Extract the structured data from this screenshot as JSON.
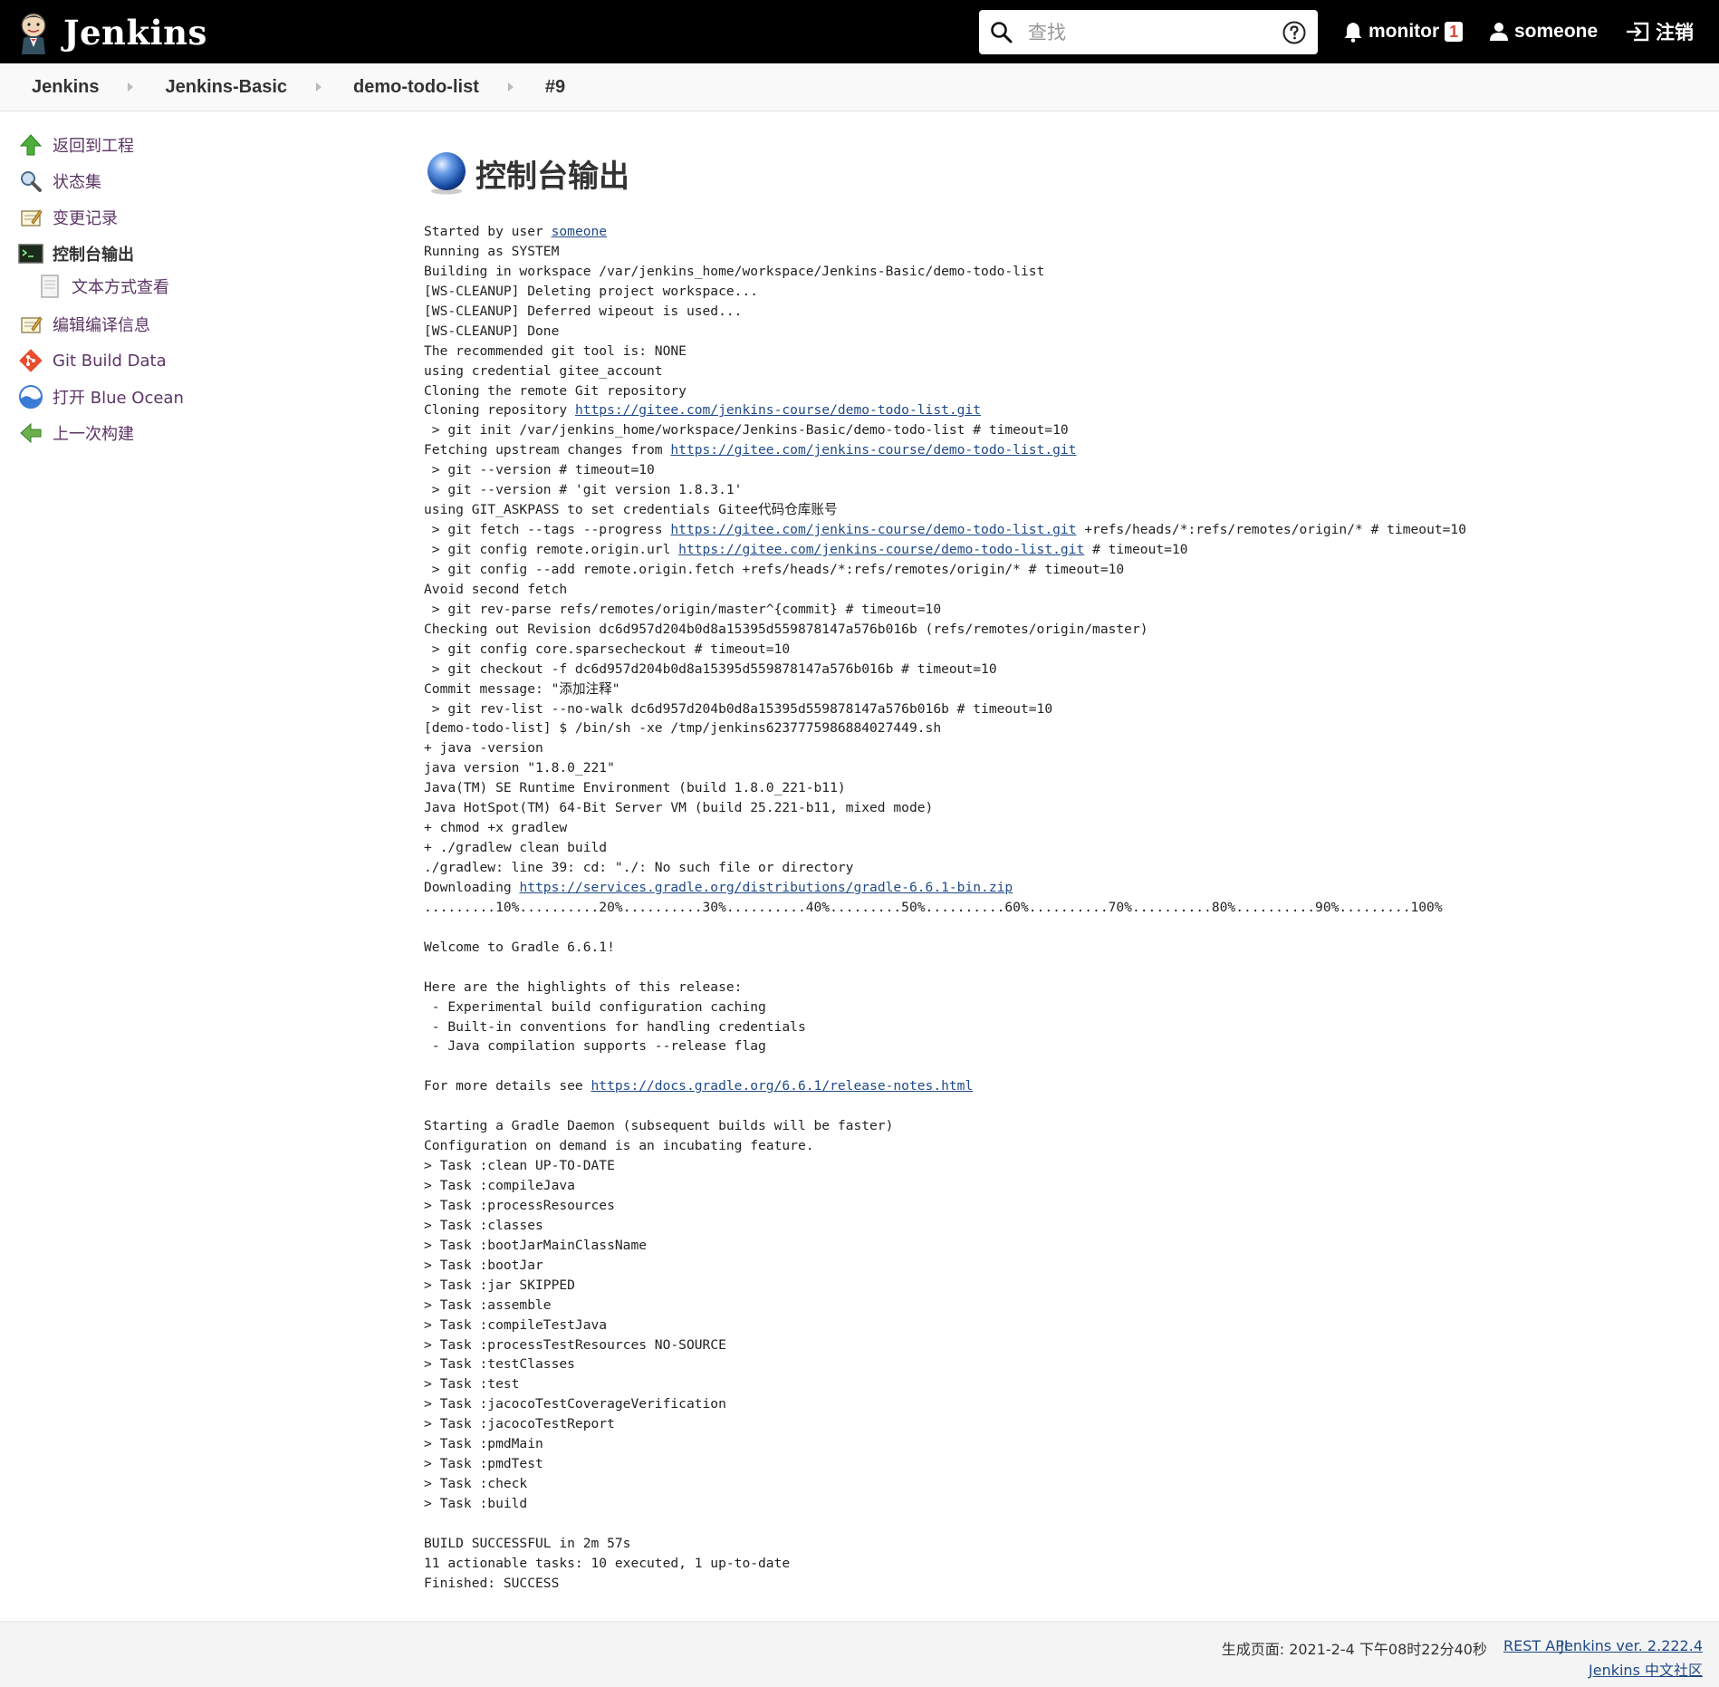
{
  "header": {
    "brand": "Jenkins",
    "search_placeholder": "查找",
    "monitor_label": "monitor",
    "monitor_count": "1",
    "user_name": "someone",
    "logout_label": "注销"
  },
  "breadcrumbs": [
    "Jenkins",
    "Jenkins-Basic",
    "demo-todo-list",
    "#9"
  ],
  "side_panel": {
    "items": [
      {
        "label": "返回到工程",
        "icon": "up-arrow-icon"
      },
      {
        "label": "状态集",
        "icon": "magnifier-icon"
      },
      {
        "label": "变更记录",
        "icon": "notepad-icon"
      },
      {
        "label": "控制台输出",
        "icon": "terminal-icon"
      },
      {
        "label": "文本方式查看",
        "icon": "document-icon"
      },
      {
        "label": "编辑编译信息",
        "icon": "notepad-icon"
      },
      {
        "label": "Git Build Data",
        "icon": "git-icon"
      },
      {
        "label": "打开 Blue Ocean",
        "icon": "blue-ocean-icon"
      },
      {
        "label": "上一次构建",
        "icon": "left-arrow-icon"
      }
    ]
  },
  "main": {
    "title": "控制台输出",
    "console": [
      "Started by user someone",
      "Running as SYSTEM",
      "Building in workspace /var/jenkins_home/workspace/Jenkins-Basic/demo-todo-list",
      "[WS-CLEANUP] Deleting project workspace...",
      "[WS-CLEANUP] Deferred wipeout is used...",
      "[WS-CLEANUP] Done",
      "The recommended git tool is: NONE",
      "using credential gitee_account",
      "Cloning the remote Git repository",
      "Cloning repository https://gitee.com/jenkins-course/demo-todo-list.git",
      " > git init /var/jenkins_home/workspace/Jenkins-Basic/demo-todo-list # timeout=10",
      "Fetching upstream changes from https://gitee.com/jenkins-course/demo-todo-list.git",
      " > git --version # timeout=10",
      " > git --version # 'git version 1.8.3.1'",
      "using GIT_ASKPASS to set credentials Gitee代码仓库账号",
      " > git fetch --tags --progress https://gitee.com/jenkins-course/demo-todo-list.git +refs/heads/*:refs/remotes/origin/* # timeout=10",
      " > git config remote.origin.url https://gitee.com/jenkins-course/demo-todo-list.git # timeout=10",
      " > git config --add remote.origin.fetch +refs/heads/*:refs/remotes/origin/* # timeout=10",
      "Avoid second fetch",
      " > git rev-parse refs/remotes/origin/master^{commit} # timeout=10",
      "Checking out Revision dc6d957d204b0d8a15395d559878147a576b016b (refs/remotes/origin/master)",
      " > git config core.sparsecheckout # timeout=10",
      " > git checkout -f dc6d957d204b0d8a15395d559878147a576b016b # timeout=10",
      "Commit message: \"添加注释\"",
      " > git rev-list --no-walk dc6d957d204b0d8a15395d559878147a576b016b # timeout=10",
      "[demo-todo-list] $ /bin/sh -xe /tmp/jenkins6237775986884027449.sh",
      "+ java -version",
      "java version \"1.8.0_221\"",
      "Java(TM) SE Runtime Environment (build 1.8.0_221-b11)",
      "Java HotSpot(TM) 64-Bit Server VM (build 25.221-b11, mixed mode)",
      "+ chmod +x gradlew",
      "+ ./gradlew clean build",
      "./gradlew: line 39: cd: \"./: No such file or directory",
      "Downloading https://services.gradle.org/distributions/gradle-6.6.1-bin.zip",
      ".........10%..........20%..........30%..........40%.........50%..........60%..........70%..........80%..........90%.........100%",
      "",
      "Welcome to Gradle 6.6.1!",
      "",
      "Here are the highlights of this release:",
      " - Experimental build configuration caching",
      " - Built-in conventions for handling credentials",
      " - Java compilation supports --release flag",
      "",
      "For more details see https://docs.gradle.org/6.6.1/release-notes.html",
      "",
      "Starting a Gradle Daemon (subsequent builds will be faster)",
      "Configuration on demand is an incubating feature.",
      "> Task :clean UP-TO-DATE",
      "> Task :compileJava",
      "> Task :processResources",
      "> Task :classes",
      "> Task :bootJarMainClassName",
      "> Task :bootJar",
      "> Task :jar SKIPPED",
      "> Task :assemble",
      "> Task :compileTestJava",
      "> Task :processTestResources NO-SOURCE",
      "> Task :testClasses",
      "> Task :test",
      "> Task :jacocoTestCoverageVerification",
      "> Task :jacocoTestReport",
      "> Task :pmdMain",
      "> Task :pmdTest",
      "> Task :check",
      "> Task :build",
      "",
      "BUILD SUCCESSFUL in 2m 57s",
      "11 actionable tasks: 10 executed, 1 up-to-date",
      "Finished: SUCCESS"
    ],
    "links": [
      "someone",
      "https://gitee.com/jenkins-course/demo-todo-list.git",
      "https://services.gradle.org/distributions/gradle-6.6.1-bin.zip",
      "https://docs.gradle.org/6.6.1/release-notes.html"
    ]
  },
  "footer": {
    "generated": "生成页面: 2021-2-4 下午08时22分40秒",
    "rest_api": "REST API",
    "version": "Jenkins ver. 2.222.4",
    "community": "Jenkins 中文社区"
  },
  "colors": {
    "header_bg": "#000000",
    "link": "#204a87",
    "side_link": "#5c3566",
    "badge": "#d24939"
  }
}
